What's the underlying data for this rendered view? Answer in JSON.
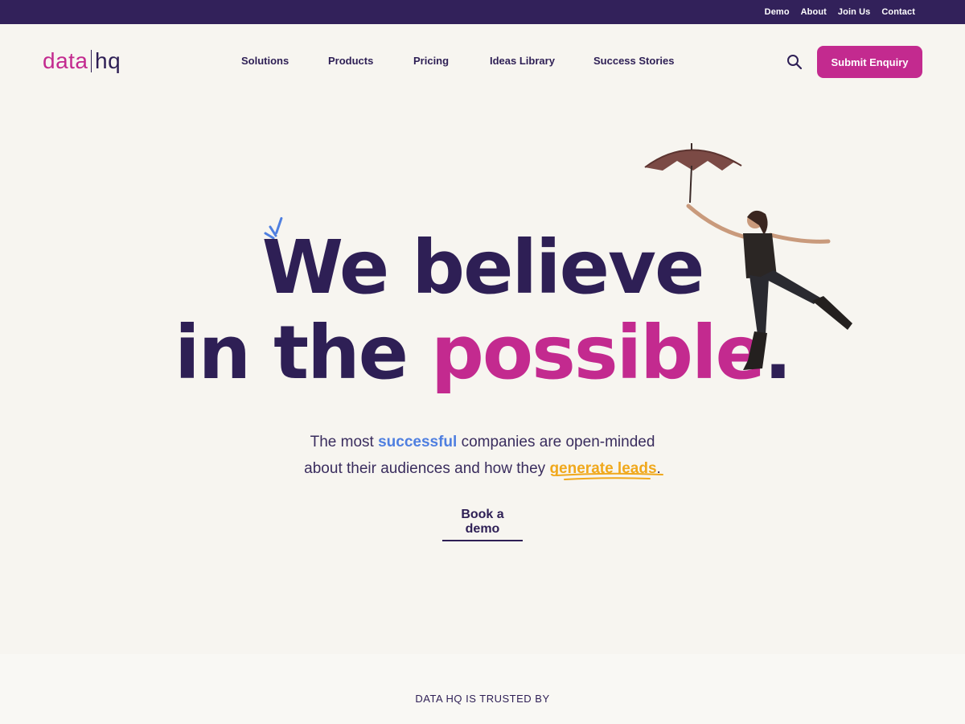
{
  "topbar": {
    "links": [
      "Demo",
      "About",
      "Join Us",
      "Contact"
    ]
  },
  "header": {
    "logo_left": "data",
    "logo_right": "hq",
    "nav": [
      "Solutions",
      "Products",
      "Pricing",
      "Ideas Library",
      "Success Stories"
    ],
    "search_icon": "search-icon",
    "cta_label": "Submit Enquiry"
  },
  "hero": {
    "line1": "We believe",
    "line2_prefix": "in the ",
    "line2_accent": "possible",
    "line2_suffix": ".",
    "sub_1": "The most ",
    "sub_blue": "successful",
    "sub_2": " companies are open-minded",
    "sub_3": "about their audiences and how they ",
    "sub_yellow": "generate leads",
    "sub_4": ".",
    "demo_label": "Book a demo"
  },
  "trusted": {
    "label": "DATA HQ IS TRUSTED BY"
  },
  "colors": {
    "brand_dark": "#32215a",
    "brand_pink": "#c32a8f",
    "accent_blue": "#4f7fe0",
    "accent_yellow": "#f0a81c",
    "background": "#f7f5f0"
  }
}
